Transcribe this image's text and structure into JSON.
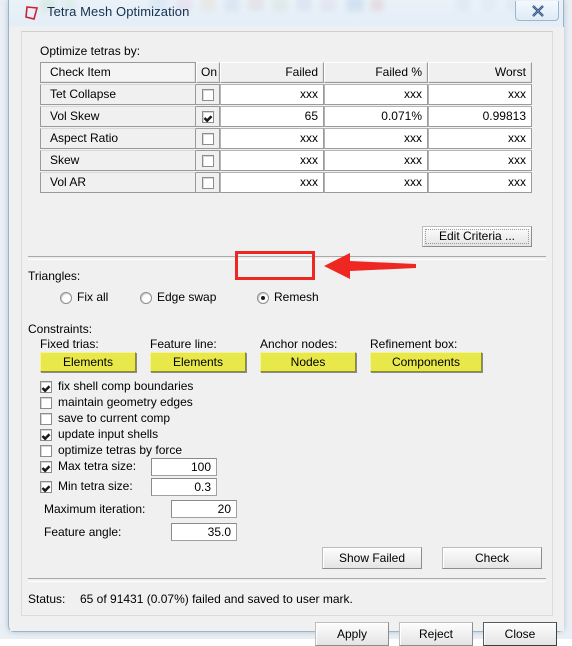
{
  "window": {
    "title": "Tetra Mesh Optimization",
    "app_icon": "tetra-icon",
    "close_label": "close-icon"
  },
  "sections": {
    "optimize_label": "Optimize tetras by:",
    "triangles_label": "Triangles:",
    "constraints_label": "Constraints:",
    "status_label": "Status:"
  },
  "table": {
    "headers": [
      "Check Item",
      "On",
      "Failed",
      "Failed %",
      "Worst"
    ],
    "rows": [
      {
        "item": "Tet Collapse",
        "on": false,
        "failed": "xxx",
        "failed_pct": "xxx",
        "worst": "xxx"
      },
      {
        "item": "Vol Skew",
        "on": true,
        "failed": "65",
        "failed_pct": "0.071%",
        "worst": "0.99813"
      },
      {
        "item": "Aspect Ratio",
        "on": false,
        "failed": "xxx",
        "failed_pct": "xxx",
        "worst": "xxx"
      },
      {
        "item": "Skew",
        "on": false,
        "failed": "xxx",
        "failed_pct": "xxx",
        "worst": "xxx"
      },
      {
        "item": "Vol AR",
        "on": false,
        "failed": "xxx",
        "failed_pct": "xxx",
        "worst": "xxx"
      }
    ]
  },
  "edit_criteria_button": "Edit Criteria ...",
  "triangles": {
    "options": [
      {
        "label": "Fix all",
        "selected": false
      },
      {
        "label": "Edge swap",
        "selected": false
      },
      {
        "label": "Remesh",
        "selected": true
      }
    ],
    "highlighted_option": "Remesh"
  },
  "constraints": [
    {
      "label": "Fixed trias:",
      "button": "Elements"
    },
    {
      "label": "Feature line:",
      "button": "Elements"
    },
    {
      "label": "Anchor nodes:",
      "button": "Nodes"
    },
    {
      "label": "Refinement box:",
      "button": "Components"
    }
  ],
  "checkboxes": [
    {
      "label": "fix shell comp boundaries",
      "checked": true
    },
    {
      "label": "maintain geometry edges",
      "checked": false
    },
    {
      "label": "save to current comp",
      "checked": false
    },
    {
      "label": "update input shells",
      "checked": true
    },
    {
      "label": "optimize tetras by force",
      "checked": false
    },
    {
      "label": "Max tetra size:",
      "checked": true,
      "value": "100"
    },
    {
      "label": "Min tetra size:",
      "checked": true,
      "value": "0.3"
    }
  ],
  "fields": [
    {
      "label": "Maximum iteration:",
      "value": "20"
    },
    {
      "label": "Feature angle:",
      "value": "35.0"
    }
  ],
  "action_buttons": {
    "show_failed": "Show Failed",
    "check": "Check"
  },
  "status_text": "65 of 91431 (0.07%) failed and saved to user mark.",
  "footer_buttons": [
    {
      "label": "Apply",
      "focus": false
    },
    {
      "label": "Reject",
      "focus": false
    },
    {
      "label": "Close",
      "focus": true
    }
  ],
  "colors": {
    "accent_yellow": "#e8e84a",
    "annotation_red": "#ee2722",
    "dialog_face": "#f0f0f0",
    "title_text": "#15314f"
  }
}
